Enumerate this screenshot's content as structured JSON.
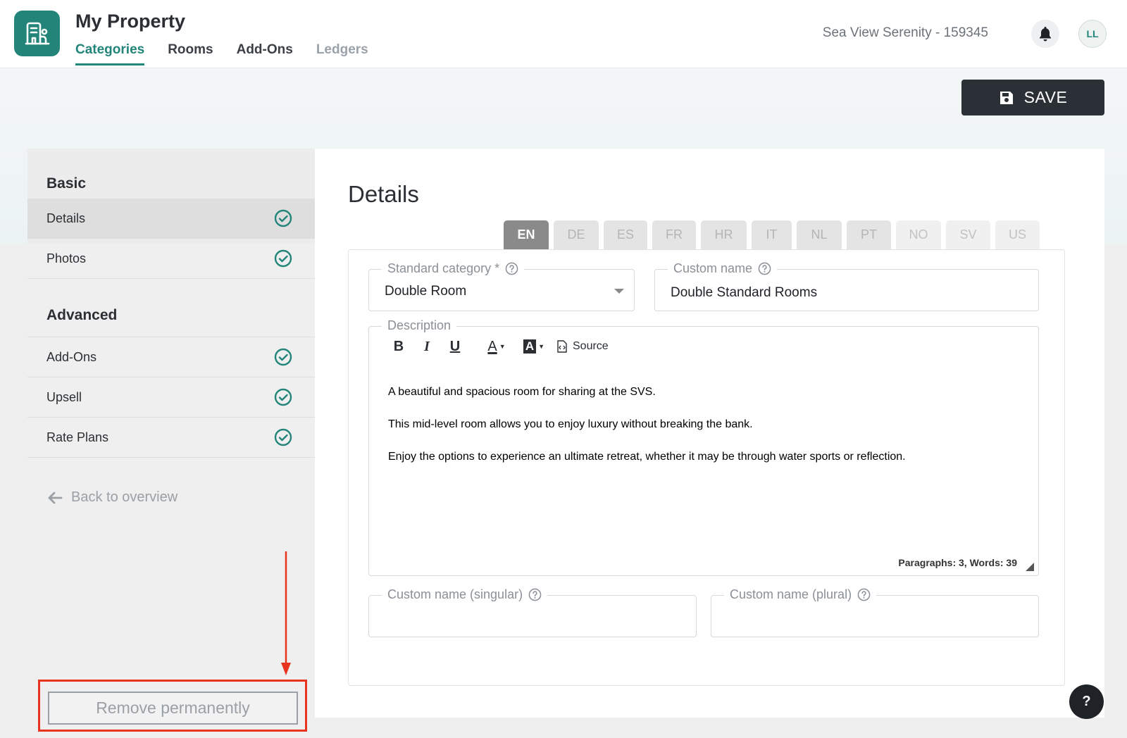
{
  "header": {
    "app_title": "My Property",
    "nav": [
      {
        "label": "Categories",
        "state": "active"
      },
      {
        "label": "Rooms",
        "state": "normal"
      },
      {
        "label": "Add-Ons",
        "state": "normal"
      },
      {
        "label": "Ledgers",
        "state": "disabled"
      }
    ],
    "property": "Sea View Serenity - 159345",
    "avatar_initials": "LL",
    "icons": {
      "logo": "building-icon",
      "notifications": "bell-icon"
    }
  },
  "toolbar": {
    "save_label": "SAVE",
    "save_icon": "floppy-disk-icon"
  },
  "sidebar": {
    "basic_heading": "Basic",
    "basic_items": [
      {
        "label": "Details",
        "complete": true,
        "selected": true
      },
      {
        "label": "Photos",
        "complete": true,
        "selected": false
      }
    ],
    "advanced_heading": "Advanced",
    "advanced_items": [
      {
        "label": "Add-Ons",
        "complete": true
      },
      {
        "label": "Upsell",
        "complete": true
      },
      {
        "label": "Rate Plans",
        "complete": true
      }
    ],
    "back_label": "Back to overview",
    "remove_label": "Remove permanently"
  },
  "details": {
    "title": "Details",
    "languages": [
      {
        "code": "EN",
        "state": "active"
      },
      {
        "code": "DE",
        "state": "normal"
      },
      {
        "code": "ES",
        "state": "normal"
      },
      {
        "code": "FR",
        "state": "normal"
      },
      {
        "code": "HR",
        "state": "normal"
      },
      {
        "code": "IT",
        "state": "normal"
      },
      {
        "code": "NL",
        "state": "normal"
      },
      {
        "code": "PT",
        "state": "normal"
      },
      {
        "code": "NO",
        "state": "faded"
      },
      {
        "code": "SV",
        "state": "faded"
      },
      {
        "code": "US",
        "state": "faded"
      }
    ],
    "standard_category": {
      "label": "Standard category *",
      "value": "Double Room"
    },
    "custom_name": {
      "label": "Custom name",
      "value": "Double Standard Rooms"
    },
    "description": {
      "label": "Description",
      "toolbar": {
        "bold": "B",
        "italic": "I",
        "underline": "U",
        "font_color": "A",
        "bg_color": "A",
        "source": "Source"
      },
      "paragraphs": [
        "A beautiful and spacious room for sharing at the SVS.",
        "This mid-level room allows you to enjoy luxury without breaking the bank.",
        "Enjoy the options to experience an ultimate retreat, whether it may be through water sports or reflection."
      ],
      "counter": "Paragraphs: 3, Words: 39"
    },
    "custom_name_singular": {
      "label": "Custom name (singular)",
      "value": ""
    },
    "custom_name_plural": {
      "label": "Custom name (plural)",
      "value": ""
    }
  },
  "help_button": "?",
  "colors": {
    "accent": "#23857a",
    "save_bg": "#2b3036",
    "annotation": "#e8331f"
  }
}
